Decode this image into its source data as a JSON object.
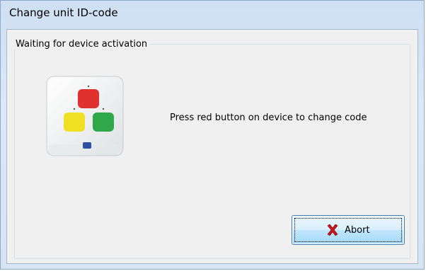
{
  "window": {
    "title": "Change unit ID-code"
  },
  "group": {
    "legend": "Waiting for device activation"
  },
  "device": {
    "icon": "device-image",
    "button_colors": [
      "#e0312e",
      "#efe024",
      "#2fa84a"
    ]
  },
  "message": "Press red button on device to change code",
  "abort_button": {
    "label": "Abort",
    "icon": "red-x-icon",
    "icon_color": "#c8161d"
  }
}
